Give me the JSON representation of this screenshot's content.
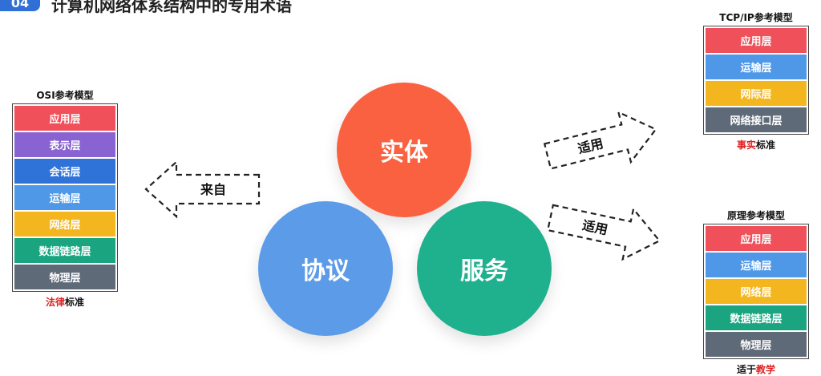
{
  "header": {
    "badge": "04",
    "title": "计算机网络体系结构中的专用术语"
  },
  "osi": {
    "title": "OSI参考模型",
    "layers": [
      {
        "label": "应用层",
        "color": "#f0505a"
      },
      {
        "label": "表示层",
        "color": "#8a63d2"
      },
      {
        "label": "会话层",
        "color": "#2f73d9"
      },
      {
        "label": "运输层",
        "color": "#4f98e8"
      },
      {
        "label": "网络层",
        "color": "#f3b61f"
      },
      {
        "label": "数据链路层",
        "color": "#1aa580"
      },
      {
        "label": "物理层",
        "color": "#5f6a78"
      }
    ],
    "footer_highlight": "法律",
    "footer_rest": "标准"
  },
  "tcpip": {
    "title": "TCP/IP参考模型",
    "layers": [
      {
        "label": "应用层",
        "color": "#f0505a"
      },
      {
        "label": "运输层",
        "color": "#4f98e8"
      },
      {
        "label": "网际层",
        "color": "#f3b61f"
      },
      {
        "label": "网络接口层",
        "color": "#5f6a78"
      }
    ],
    "footer_highlight": "事实",
    "footer_rest": "标准"
  },
  "principle": {
    "title": "原理参考模型",
    "layers": [
      {
        "label": "应用层",
        "color": "#f0505a"
      },
      {
        "label": "运输层",
        "color": "#4f98e8"
      },
      {
        "label": "网络层",
        "color": "#f3b61f"
      },
      {
        "label": "数据链路层",
        "color": "#1aa580"
      },
      {
        "label": "物理层",
        "color": "#5f6a78"
      }
    ],
    "footer_rest": "适于",
    "footer_highlight": "教学"
  },
  "circles": {
    "entity": {
      "label": "实体",
      "color": "#fa6140"
    },
    "protocol": {
      "label": "协议",
      "color": "#5c9be8"
    },
    "service": {
      "label": "服务",
      "color": "#1fb08e"
    }
  },
  "arrows": {
    "left": "来自",
    "top_right": "适用",
    "bottom_right": "适用"
  }
}
